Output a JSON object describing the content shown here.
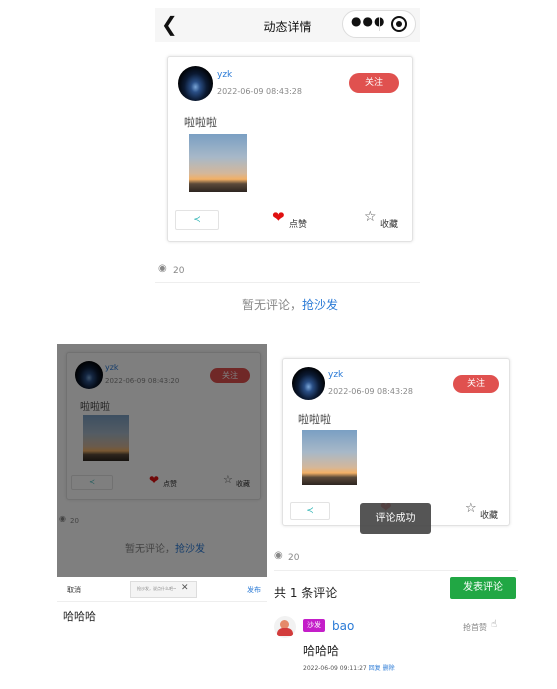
{
  "nav": {
    "back_icon": "chevron-left-icon",
    "title": "动态详情",
    "more_icon": "more-dots-icon",
    "target_icon": "target-circle-icon"
  },
  "post": {
    "username": "yzk",
    "time": "2022-06-09 08:43:28",
    "time_dim": "2022-06-09 08:43:20",
    "follow_label": "关注",
    "text": "啦啦啦",
    "like_label": "点赞",
    "collect_label": "收藏",
    "views": "20",
    "share_icon": "share-icon",
    "heart_color": "#e01010",
    "follow_color": "#e0514f"
  },
  "comments_empty": {
    "prefix": "暂无评论，",
    "link": "抢沙发"
  },
  "keyboard": {
    "cancel": "取消",
    "placeholder": "抢沙发，说点什么吧~",
    "send": "发布",
    "typed": "哈哈哈"
  },
  "toast": "评论成功",
  "comments": {
    "count_label": "共 1 条评论",
    "post_button": "发表评论",
    "post_button_color": "#21a744",
    "items": [
      {
        "badge": "沙发",
        "badge_color": "#c41ec9",
        "user": "bao",
        "like_label": "抢首赞",
        "text": "哈哈哈",
        "time": "2022-06-09 09:11:27",
        "reply": "回复",
        "delete": "删除"
      }
    ]
  }
}
